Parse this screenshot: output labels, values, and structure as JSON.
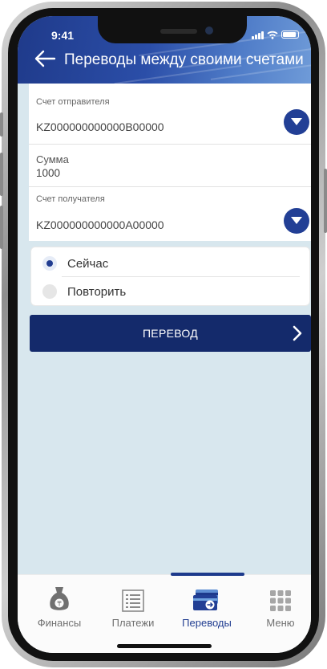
{
  "status_bar": {
    "time": "9:41"
  },
  "header": {
    "title": "Переводы между своими счетами"
  },
  "form": {
    "sender_label": "Счет отправителя",
    "sender_value": "KZ000000000000B00000",
    "amount_label": "Сумма",
    "amount_value": "1000",
    "recipient_label": "Счет получателя",
    "recipient_value": "KZ000000000000A00000"
  },
  "schedule": {
    "options": [
      {
        "label": "Сейчас",
        "selected": true
      },
      {
        "label": "Повторить",
        "selected": false
      }
    ]
  },
  "submit": {
    "label": "ПЕРЕВОД"
  },
  "tabbar": {
    "items": [
      {
        "label": "Финансы",
        "icon": "money-bag-icon",
        "active": false
      },
      {
        "label": "Платежи",
        "icon": "list-icon",
        "active": false
      },
      {
        "label": "Переводы",
        "icon": "card-transfer-icon",
        "active": true
      },
      {
        "label": "Меню",
        "icon": "grid-icon",
        "active": false
      }
    ]
  },
  "colors": {
    "brand_dark": "#142a6b",
    "brand_blue": "#223f95",
    "screen_bg": "#d8e7ee"
  }
}
